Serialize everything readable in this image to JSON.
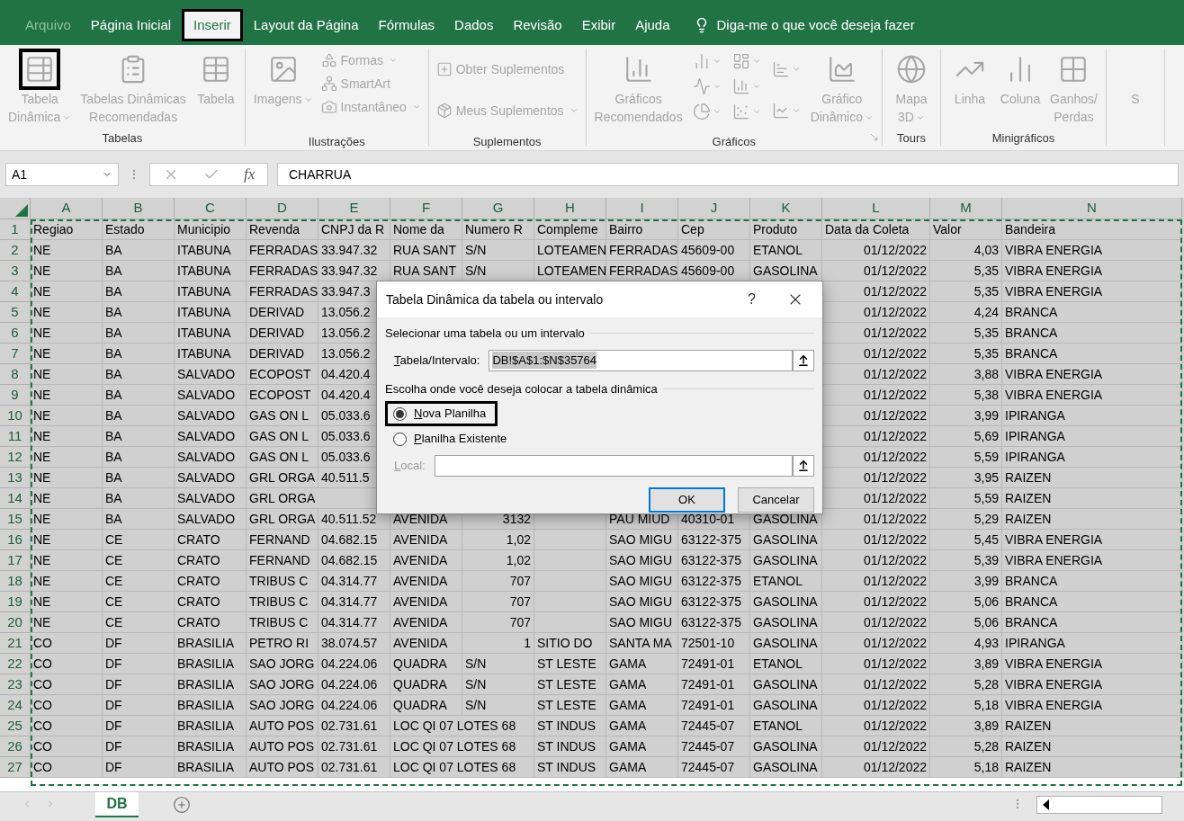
{
  "menu": {
    "tabs": [
      {
        "label": "Arquivo",
        "selected": false,
        "disabled": true,
        "highlighted": false
      },
      {
        "label": "Página Inicial",
        "selected": false,
        "disabled": false,
        "highlighted": false
      },
      {
        "label": "Inserir",
        "selected": true,
        "disabled": false,
        "highlighted": true
      },
      {
        "label": "Layout da Página",
        "selected": false,
        "disabled": false,
        "highlighted": false
      },
      {
        "label": "Fórmulas",
        "selected": false,
        "disabled": false,
        "highlighted": false
      },
      {
        "label": "Dados",
        "selected": false,
        "disabled": false,
        "highlighted": false
      },
      {
        "label": "Revisão",
        "selected": false,
        "disabled": false,
        "highlighted": false
      },
      {
        "label": "Exibir",
        "selected": false,
        "disabled": false,
        "highlighted": false
      },
      {
        "label": "Ajuda",
        "selected": false,
        "disabled": false,
        "highlighted": false
      }
    ],
    "tell_me": "Diga-me o que você deseja fazer"
  },
  "ribbon": {
    "groups": [
      {
        "label": "Tabelas",
        "launcher": false,
        "buttons": [
          {
            "kind": "large",
            "label": "Tabela\nDinâmica",
            "dropdown": true,
            "disabled": true,
            "highlighted": true
          },
          {
            "kind": "large",
            "label": "Tabelas Dinâmicas\nRecomendadas",
            "dropdown": false,
            "disabled": true,
            "highlighted": false
          },
          {
            "kind": "large",
            "label": "Tabela",
            "dropdown": false,
            "disabled": true,
            "highlighted": false
          }
        ]
      },
      {
        "label": "Ilustrações",
        "launcher": false,
        "buttons": [
          {
            "kind": "large",
            "label": "Imagens",
            "dropdown": true,
            "disabled": true,
            "highlighted": false
          },
          {
            "kind": "small",
            "label": "Formas",
            "dropdown": true,
            "disabled": true,
            "highlighted": false
          },
          {
            "kind": "small",
            "label": "SmartArt",
            "dropdown": false,
            "disabled": true,
            "highlighted": false
          },
          {
            "kind": "small",
            "label": "Instantâneo",
            "dropdown": true,
            "disabled": true,
            "highlighted": false
          }
        ]
      },
      {
        "label": "Suplementos",
        "launcher": false,
        "buttons": [
          {
            "kind": "small",
            "label": "Obter Suplementos",
            "dropdown": false,
            "disabled": true,
            "highlighted": false
          },
          {
            "kind": "small",
            "label": "Meus Suplementos",
            "dropdown": true,
            "disabled": true,
            "highlighted": false
          }
        ]
      },
      {
        "label": "Gráficos",
        "launcher": true,
        "buttons": [
          {
            "kind": "large",
            "label": "Gráficos\nRecomendados",
            "dropdown": false,
            "disabled": true,
            "highlighted": false
          },
          {
            "kind": "icon",
            "dropdown": true,
            "disabled": true,
            "highlighted": false
          },
          {
            "kind": "icon",
            "dropdown": true,
            "disabled": true,
            "highlighted": false
          },
          {
            "kind": "icon",
            "dropdown": true,
            "disabled": true,
            "highlighted": false
          },
          {
            "kind": "icon",
            "dropdown": true,
            "disabled": true,
            "highlighted": false
          },
          {
            "kind": "icon",
            "dropdown": true,
            "disabled": true,
            "highlighted": false
          },
          {
            "kind": "icon",
            "dropdown": true,
            "disabled": true,
            "highlighted": false
          },
          {
            "kind": "icon",
            "dropdown": true,
            "disabled": true,
            "highlighted": false
          },
          {
            "kind": "icon",
            "dropdown": true,
            "disabled": true,
            "highlighted": false
          },
          {
            "kind": "large",
            "label": "Gráfico\nDinâmico",
            "dropdown": true,
            "disabled": true,
            "highlighted": false
          }
        ]
      },
      {
        "label": "Tours",
        "launcher": false,
        "buttons": [
          {
            "kind": "large",
            "label": "Mapa\n3D",
            "dropdown": true,
            "disabled": true,
            "highlighted": false
          }
        ]
      },
      {
        "label": "Minigráficos",
        "launcher": false,
        "buttons": [
          {
            "kind": "large",
            "label": "Linha",
            "dropdown": false,
            "disabled": true,
            "highlighted": false
          },
          {
            "kind": "large",
            "label": "Coluna",
            "dropdown": false,
            "disabled": true,
            "highlighted": false
          },
          {
            "kind": "large",
            "label": "Ganhos/\nPerdas",
            "dropdown": false,
            "disabled": true,
            "highlighted": false
          }
        ]
      },
      {
        "launcher": false,
        "buttons": [
          {
            "kind": "large",
            "label": "S",
            "dropdown": false,
            "disabled": true,
            "highlighted": false
          }
        ]
      }
    ]
  },
  "formula_bar": {
    "name_box": "A1",
    "function_label": "fx",
    "value": "CHARRUA"
  },
  "sheet": {
    "selected": true,
    "columns": [
      "A",
      "B",
      "C",
      "D",
      "E",
      "F",
      "G",
      "H",
      "I",
      "J",
      "K",
      "L",
      "M",
      "N"
    ],
    "rows": [
      {
        "number": "1",
        "cells": [
          "Regiao",
          "Estado",
          "Municipio",
          "Revenda",
          "CNPJ da R",
          "Nome da",
          "Numero R",
          "Compleme",
          "Bairro",
          "Cep",
          "Produto",
          "Data da Coleta",
          "Valor",
          "Bandeira"
        ]
      },
      {
        "number": "2",
        "cells": [
          "NE",
          "BA",
          "ITABUNA",
          "FERRADAS",
          "33.947.32",
          "RUA SANT",
          "S/N",
          "LOTEAMEN",
          "FERRADAS",
          "45609-00",
          "ETANOL",
          "01/12/2022",
          "4,03",
          "VIBRA ENERGIA"
        ]
      },
      {
        "number": "3",
        "cells": [
          "NE",
          "BA",
          "ITABUNA",
          "FERRADAS",
          "33.947.32",
          "RUA SANT",
          "S/N",
          "LOTEAMEN",
          "FERRADAS",
          "45609-00",
          "GASOLINA",
          "01/12/2022",
          "5,35",
          "VIBRA ENERGIA"
        ]
      },
      {
        "number": "4",
        "cells": [
          "NE",
          "BA",
          "ITABUNA",
          "FERRADAS",
          "33.947.3",
          null,
          null,
          null,
          null,
          null,
          null,
          "01/12/2022",
          "5,35",
          "VIBRA ENERGIA"
        ]
      },
      {
        "number": "5",
        "cells": [
          "NE",
          "BA",
          "ITABUNA",
          "DERIVAD",
          "13.056.2",
          null,
          null,
          null,
          null,
          null,
          null,
          "01/12/2022",
          "4,24",
          "BRANCA"
        ]
      },
      {
        "number": "6",
        "cells": [
          "NE",
          "BA",
          "ITABUNA",
          "DERIVAD",
          "13.056.2",
          null,
          null,
          null,
          null,
          null,
          null,
          "01/12/2022",
          "5,35",
          "BRANCA"
        ]
      },
      {
        "number": "7",
        "cells": [
          "NE",
          "BA",
          "ITABUNA",
          "DERIVAD",
          "13.056.2",
          null,
          null,
          null,
          null,
          null,
          null,
          "01/12/2022",
          "5,35",
          "BRANCA"
        ]
      },
      {
        "number": "8",
        "cells": [
          "NE",
          "BA",
          "SALVADO",
          "ECOPOST",
          "04.420.4",
          null,
          null,
          null,
          null,
          null,
          null,
          "01/12/2022",
          "3,88",
          "VIBRA ENERGIA"
        ]
      },
      {
        "number": "9",
        "cells": [
          "NE",
          "BA",
          "SALVADO",
          "ECOPOST",
          "04.420.4",
          null,
          null,
          null,
          null,
          null,
          null,
          "01/12/2022",
          "5,38",
          "VIBRA ENERGIA"
        ]
      },
      {
        "number": "10",
        "cells": [
          "NE",
          "BA",
          "SALVADO",
          "GAS ON L",
          "05.033.6",
          null,
          null,
          null,
          null,
          null,
          null,
          "01/12/2022",
          "3,99",
          "IPIRANGA"
        ]
      },
      {
        "number": "11",
        "cells": [
          "NE",
          "BA",
          "SALVADO",
          "GAS ON L",
          "05.033.6",
          null,
          null,
          null,
          null,
          null,
          null,
          "01/12/2022",
          "5,69",
          "IPIRANGA"
        ]
      },
      {
        "number": "12",
        "cells": [
          "NE",
          "BA",
          "SALVADO",
          "GAS ON L",
          "05.033.6",
          null,
          null,
          null,
          null,
          null,
          null,
          "01/12/2022",
          "5,59",
          "IPIRANGA"
        ]
      },
      {
        "number": "13",
        "cells": [
          "NE",
          "BA",
          "SALVADO",
          "GRL ORGA",
          "40.511.5",
          null,
          null,
          null,
          null,
          null,
          null,
          "01/12/2022",
          "3,95",
          "RAIZEN"
        ]
      },
      {
        "number": "14",
        "cells": [
          "NE",
          "BA",
          "SALVADO",
          "GRL ORGA",
          null,
          null,
          null,
          null,
          null,
          null,
          null,
          "01/12/2022",
          "5,59",
          "RAIZEN"
        ]
      },
      {
        "number": "15",
        "cells": [
          "NE",
          "BA",
          "SALVADO",
          "GRL ORGA",
          "40.511.52",
          "AVENIDA",
          "3132",
          null,
          "PAU MIUD",
          "40310-01",
          "GASOLINA",
          "01/12/2022",
          "5,29",
          "RAIZEN"
        ]
      },
      {
        "number": "16",
        "cells": [
          "NE",
          "CE",
          "CRATO",
          "FERNAND",
          "04.682.15",
          "AVENIDA",
          "1,02",
          null,
          "SAO MIGU",
          "63122-375",
          "GASOLINA",
          "01/12/2022",
          "5,45",
          "VIBRA ENERGIA"
        ]
      },
      {
        "number": "17",
        "cells": [
          "NE",
          "CE",
          "CRATO",
          "FERNAND",
          "04.682.15",
          "AVENIDA",
          "1,02",
          null,
          "SAO MIGU",
          "63122-375",
          "GASOLINA",
          "01/12/2022",
          "5,39",
          "VIBRA ENERGIA"
        ]
      },
      {
        "number": "18",
        "cells": [
          "NE",
          "CE",
          "CRATO",
          "TRIBUS C",
          "04.314.77",
          "AVENIDA",
          "707",
          null,
          "SAO MIGU",
          "63122-375",
          "ETANOL",
          "01/12/2022",
          "3,99",
          "BRANCA"
        ]
      },
      {
        "number": "19",
        "cells": [
          "NE",
          "CE",
          "CRATO",
          "TRIBUS C",
          "04.314.77",
          "AVENIDA",
          "707",
          null,
          "SAO MIGU",
          "63122-375",
          "GASOLINA",
          "01/12/2022",
          "5,06",
          "BRANCA"
        ]
      },
      {
        "number": "20",
        "cells": [
          "NE",
          "CE",
          "CRATO",
          "TRIBUS C",
          "04.314.77",
          "AVENIDA",
          "707",
          null,
          "SAO MIGU",
          "63122-375",
          "GASOLINA",
          "01/12/2022",
          "5,06",
          "BRANCA"
        ]
      },
      {
        "number": "21",
        "cells": [
          "CO",
          "DF",
          "BRASILIA",
          "PETRO RI",
          "38.074.57",
          "AVENIDA",
          "1",
          "SITIO DO",
          "SANTA MA",
          "72501-10",
          "GASOLINA",
          "01/12/2022",
          "4,93",
          "IPIRANGA"
        ]
      },
      {
        "number": "22",
        "cells": [
          "CO",
          "DF",
          "BRASILIA",
          "SAO JORG",
          "04.224.06",
          "QUADRA",
          "S/N",
          "ST LESTE",
          "GAMA",
          "72491-01",
          "ETANOL",
          "01/12/2022",
          "3,89",
          "VIBRA ENERGIA"
        ]
      },
      {
        "number": "23",
        "cells": [
          "CO",
          "DF",
          "BRASILIA",
          "SAO JORG",
          "04.224.06",
          "QUADRA",
          "S/N",
          "ST LESTE",
          "GAMA",
          "72491-01",
          "GASOLINA",
          "01/12/2022",
          "5,28",
          "VIBRA ENERGIA"
        ]
      },
      {
        "number": "24",
        "cells": [
          "CO",
          "DF",
          "BRASILIA",
          "SAO JORG",
          "04.224.06",
          "QUADRA",
          "S/N",
          "ST LESTE",
          "GAMA",
          "72491-01",
          "GASOLINA",
          "01/12/2022",
          "5,18",
          "VIBRA ENERGIA"
        ]
      },
      {
        "number": "25",
        "cells": [
          "CO",
          "DF",
          "BRASILIA",
          "AUTO POS",
          "02.731.61",
          "LOC QI 07 LOTES 68",
          null,
          "ST INDUS",
          "GAMA",
          "72445-07",
          "ETANOL",
          "01/12/2022",
          "3,89",
          "RAIZEN"
        ]
      },
      {
        "number": "26",
        "cells": [
          "CO",
          "DF",
          "BRASILIA",
          "AUTO POS",
          "02.731.61",
          "LOC QI 07 LOTES 68",
          null,
          "ST INDUS",
          "GAMA",
          "72445-07",
          "GASOLINA",
          "01/12/2022",
          "5,28",
          "RAIZEN"
        ]
      },
      {
        "number": "27",
        "cells": [
          "CO",
          "DF",
          "BRASILIA",
          "AUTO POS",
          "02.731.61",
          "LOC QI 07 LOTES 68",
          null,
          "ST INDUS",
          "GAMA",
          "72445-07",
          "GASOLINA",
          "01/12/2022",
          "5,18",
          "RAIZEN"
        ]
      }
    ]
  },
  "dialog": {
    "title": "Tabela Dinâmica da tabela ou intervalo",
    "help": "?",
    "source_section": "Selecionar uma tabela ou um intervalo",
    "range_label": "Tabela/Intervalo:",
    "range_value": "DB!$A$1:$N$35764",
    "target_section": "Escolha onde você deseja colocar a tabela dinâmica",
    "options": [
      {
        "label": "Nova Planilha",
        "selected": true,
        "highlighted": true
      },
      {
        "label": "Planilha Existente",
        "selected": false,
        "highlighted": false
      }
    ],
    "location": {
      "label": "Local:",
      "disabled": true
    },
    "buttons": [
      {
        "label": "OK",
        "default": true
      },
      {
        "label": "Cancelar",
        "default": false
      }
    ]
  },
  "sheet_tabs": [
    {
      "label": "DB",
      "selected": true
    }
  ]
}
